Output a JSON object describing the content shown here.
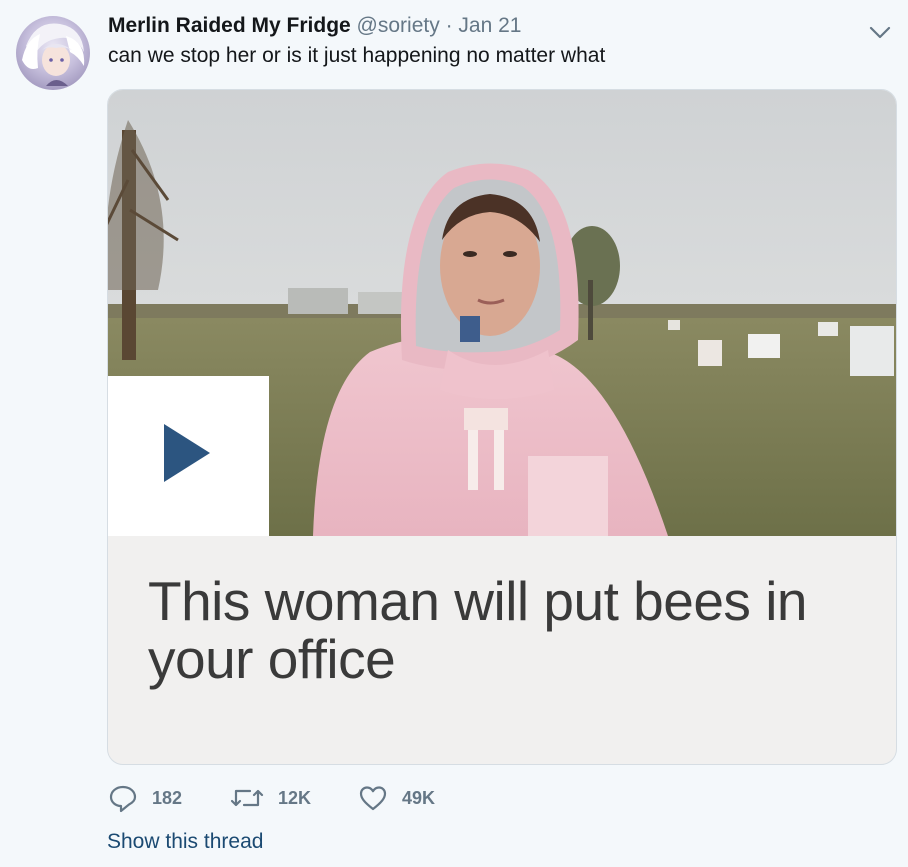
{
  "tweet": {
    "author_name": "Merlin Raided My Fridge",
    "handle": "@soriety",
    "separator": "·",
    "date": "Jan 21",
    "text": "can we stop her or is it just happening no matter what"
  },
  "card": {
    "title": "This woman will put bees in your office",
    "play_icon": "play-icon",
    "play_color": "#2c5580"
  },
  "actions": {
    "replies": "182",
    "retweets": "12K",
    "likes": "49K"
  },
  "footer": {
    "show_thread": "Show this thread"
  },
  "colors": {
    "background": "#f4f8fb",
    "muted": "#657786",
    "link": "#1b4a72"
  }
}
